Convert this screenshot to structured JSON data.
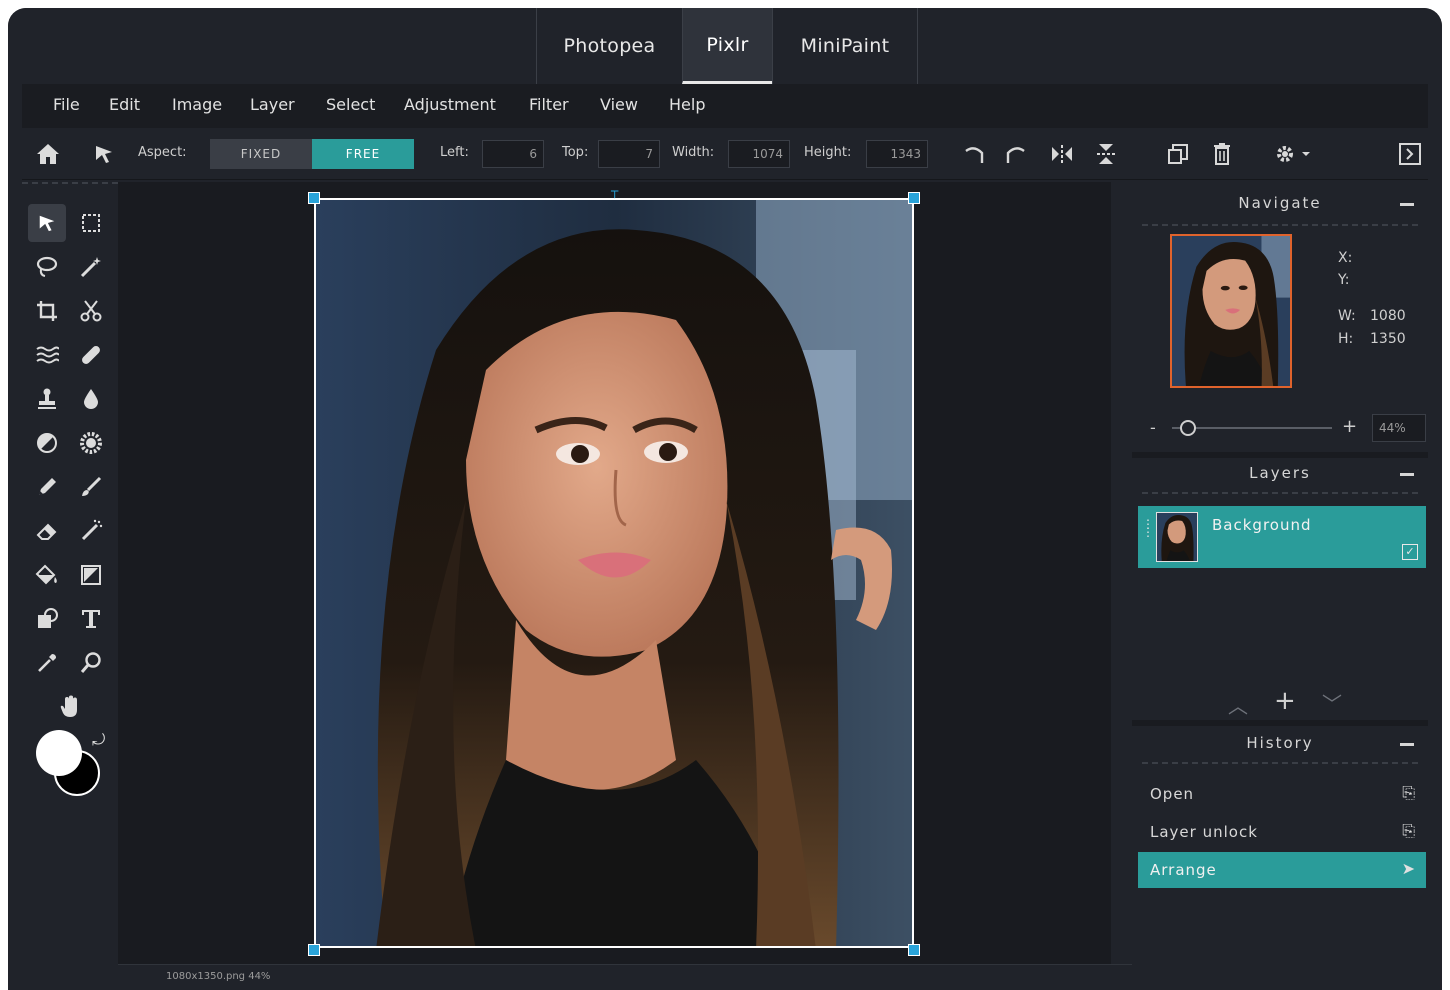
{
  "tabs": [
    {
      "label": "Photopea"
    },
    {
      "label": "Pixlr"
    },
    {
      "label": "MiniPaint"
    }
  ],
  "menu": [
    "File",
    "Edit",
    "Image",
    "Layer",
    "Select",
    "Adjustment",
    "Filter",
    "View",
    "Help"
  ],
  "toolbar": {
    "aspect_label": "Aspect:",
    "fixed_label": "FIXED",
    "free_label": "FREE",
    "left_label": "Left:",
    "left_value": "6",
    "top_label": "Top:",
    "top_value": "7",
    "width_label": "Width:",
    "width_value": "1074",
    "height_label": "Height:",
    "height_value": "1343"
  },
  "canvas": {
    "status": "1080x1350.png 44%"
  },
  "navigate": {
    "title": "Navigate",
    "x_label": "X:",
    "y_label": "Y:",
    "w_label": "W:",
    "w_value": "1080",
    "h_label": "H:",
    "h_value": "1350",
    "zoom_minus": "-",
    "zoom_plus": "+",
    "zoom_value": "44%",
    "zoom_level": 0.1
  },
  "layers": {
    "title": "Layers",
    "items": [
      {
        "name": "Background"
      }
    ]
  },
  "history": {
    "title": "History",
    "items": [
      {
        "label": "Open"
      },
      {
        "label": "Layer unlock"
      },
      {
        "label": "Arrange"
      }
    ]
  },
  "colors": {
    "accent": "#2a9c9a",
    "primary_color": "#ffffff",
    "secondary_color": "#000000",
    "selection_handle": "#29a3d9"
  }
}
